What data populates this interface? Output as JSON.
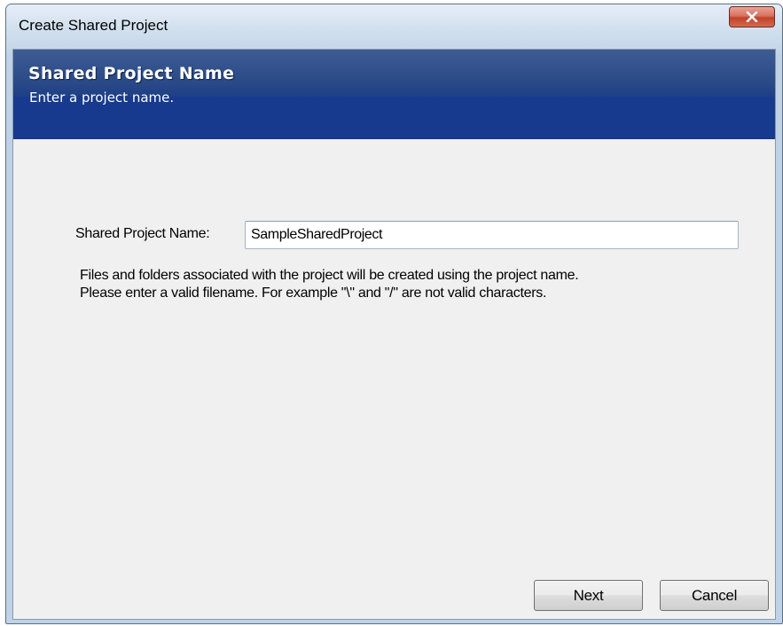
{
  "window": {
    "title": "Create Shared Project"
  },
  "header": {
    "title": "Shared Project Name",
    "subtitle": "Enter a project name."
  },
  "form": {
    "name_label": "Shared Project Name:",
    "name_value": "SampleSharedProject",
    "help_line_1": "Files and folders associated with the project will be created using the project name.",
    "help_line_2": "Please enter a valid filename. For example \"\\\" and \"/\" are not valid characters."
  },
  "buttons": {
    "next_label": "Next",
    "cancel_label": "Cancel"
  },
  "icons": {
    "close": "close-icon"
  },
  "colors": {
    "banner": "#173a8e",
    "close_button": "#c2412c",
    "client_background": "#f0f0f0"
  }
}
